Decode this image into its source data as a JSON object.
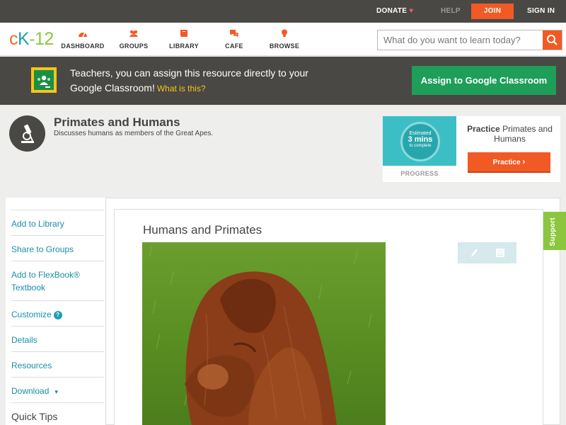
{
  "topbar": {
    "donate": "DONATE",
    "help": "HELP",
    "join": "JOIN",
    "signin": "SIGN IN"
  },
  "logo": {
    "c": "c",
    "k": "K",
    "dash": "-",
    "num": "12"
  },
  "nav": {
    "dashboard": "DASHBOARD",
    "groups": "GROUPS",
    "library": "LIBRARY",
    "cafe": "CAFE",
    "browse": "BROWSE"
  },
  "search": {
    "placeholder": "What do you want to learn today?"
  },
  "google_banner": {
    "text": "Teachers, you can assign this resource directly to your Google Classroom!",
    "what": "What is this?",
    "button": "Assign to Google Classroom"
  },
  "lesson": {
    "title": "Primates and Humans",
    "subtitle": "Discusses humans as members of the Great Apes."
  },
  "practice": {
    "estimated": "Estimated",
    "mins": "3 mins",
    "to_complete": "to complete",
    "progress_label": "PROGRESS",
    "title_bold": "Practice",
    "title_rest": "Primates and Humans",
    "button": "Practice"
  },
  "sidebar": {
    "items": [
      "Add to Library",
      "Share to Groups",
      "Add to FlexBook® Textbook",
      "Customize",
      "Details",
      "Resources",
      "Download",
      "Quick Tips"
    ],
    "customize_badge": "?",
    "download_caret": "▼"
  },
  "main": {
    "title": "Humans and Primates"
  },
  "support": "Support",
  "colors": {
    "accent_orange": "#f15a24",
    "teal_link": "#1a8ea8",
    "google_green": "#1e9e58",
    "support_green": "#8cc63f",
    "dark_bar": "#4a4845"
  }
}
